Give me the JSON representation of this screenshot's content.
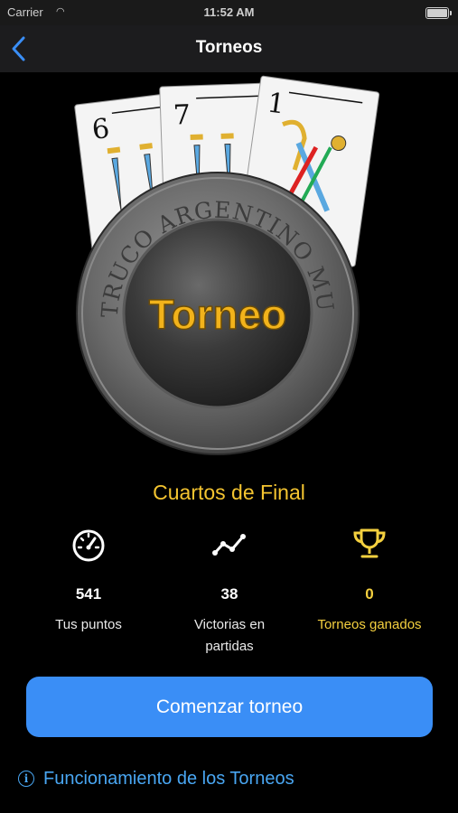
{
  "status_bar": {
    "carrier": "Carrier",
    "time": "11:52 AM"
  },
  "nav": {
    "title": "Torneos",
    "back_icon": "chevron-left-icon"
  },
  "hero": {
    "cards": [
      "6",
      "7",
      "1"
    ],
    "coin_text": "TRUCO ARGENTINO MULTITORNEO",
    "coin_title": "Torneo"
  },
  "stage": "Cuartos de Final",
  "stats": [
    {
      "icon": "speedometer-icon",
      "value": "541",
      "label": "Tus puntos"
    },
    {
      "icon": "line-chart-icon",
      "value": "38",
      "label": "Victorias en partidas"
    },
    {
      "icon": "trophy-icon",
      "value": "0",
      "label": "Torneos ganados"
    }
  ],
  "start_button": "Comenzar torneo",
  "info_link": "Funcionamiento de los Torneos",
  "colors": {
    "accent_blue": "#3a8ef6",
    "gold": "#f4c430",
    "link": "#49a6f2"
  }
}
